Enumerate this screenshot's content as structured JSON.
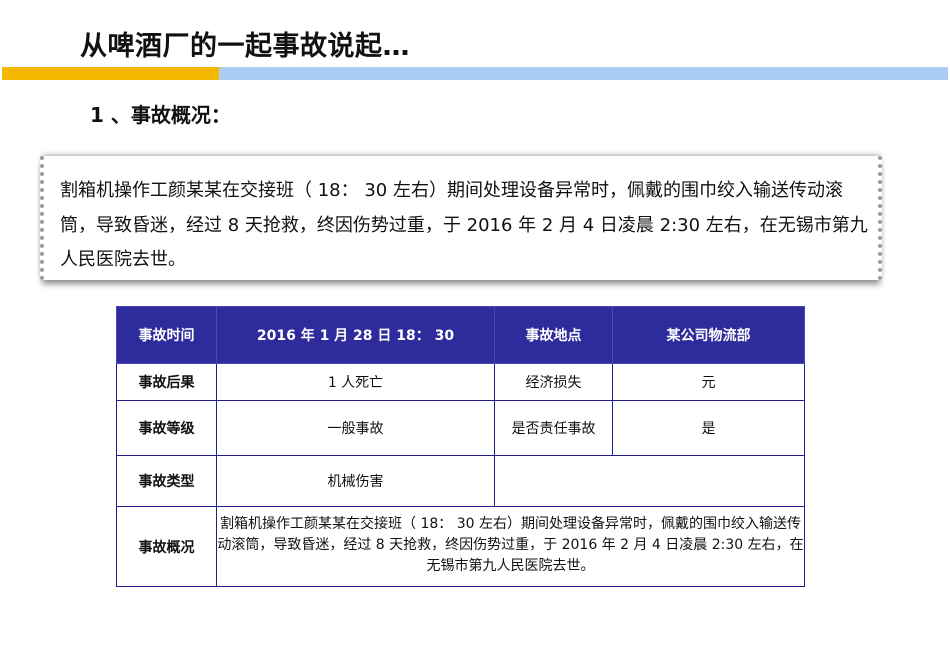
{
  "slide": {
    "title": "从啤酒厂的一起事故说起…",
    "section_heading": "1 、事故概况：",
    "summary_text": "割箱机操作工颜某某在交接班（ 18： 30 左右）期间处理设备异常时，佩戴的围巾绞入输送传动滚筒，导致昏迷，经过 8 天抢救，终因伤势过重，于 2016 年 2 月 4 日凌晨 2:30 左右，在无锡市第九人民医院去世。"
  },
  "colors": {
    "accent_yellow": "#f5b800",
    "accent_blue": "#a9cdf4",
    "table_header": "#2e2c9c",
    "table_border": "#1f1d8c"
  },
  "table": {
    "row1": {
      "label1": "事故时间",
      "value1": "2016 年 1 月 28 日 18： 30",
      "label2": "事故地点",
      "value2": "某公司物流部"
    },
    "row2": {
      "label1": "事故后果",
      "value1": "1 人死亡",
      "label2": "经济损失",
      "value2": "元"
    },
    "row3": {
      "label1": "事故等级",
      "value1": "一般事故",
      "label2": "是否责任事故",
      "value2": "是"
    },
    "row4": {
      "label1": "事故类型",
      "value1": "机械伤害"
    },
    "row5": {
      "label1": "事故概况",
      "value1": "割箱机操作工颜某某在交接班（ 18： 30 左右）期间处理设备异常时，佩戴的围巾绞入输送传动滚筒，导致昏迷，经过 8 天抢救，终因伤势过重，于 2016 年 2 月 4 日凌晨 2:30 左右，在无锡市第九人民医院去世。"
    }
  }
}
